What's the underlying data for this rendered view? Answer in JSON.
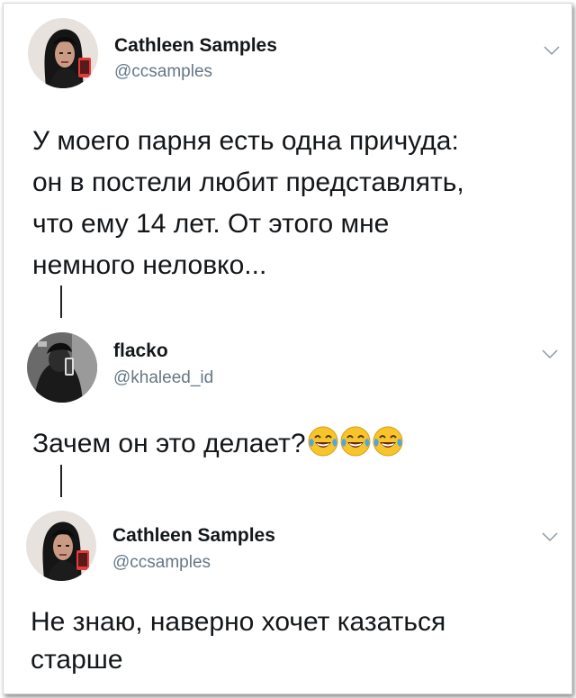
{
  "thread": [
    {
      "name": "Cathleen Samples",
      "handle": "@ccsamples",
      "text_lines": [
        "У моего парня есть одна причуда:",
        "он в постели любит представлять,",
        "что ему 14 лет. От этого мне",
        "немного неловко..."
      ]
    },
    {
      "name": "flacko",
      "handle": "@khaleed_id",
      "text_lines": [
        "Зачем он это делает?"
      ],
      "emoji": [
        "face-with-tears-of-joy",
        "face-with-tears-of-joy",
        "face-with-tears-of-joy"
      ]
    },
    {
      "name": "Cathleen Samples",
      "handle": "@ccsamples",
      "text_lines": [
        "Не знаю, наверно хочет казаться",
        "старше"
      ]
    }
  ],
  "colors": {
    "name": "#14171a",
    "handle": "#657786",
    "thread_line": "#222222",
    "chevron": "#8899a6"
  }
}
